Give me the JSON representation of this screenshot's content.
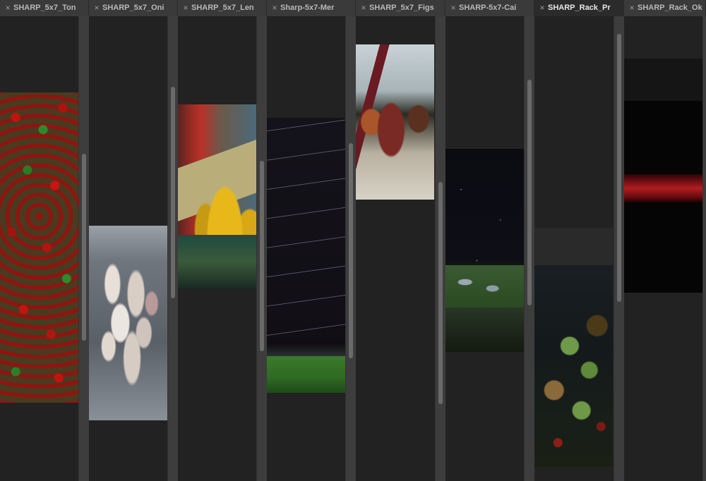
{
  "tabs": [
    {
      "title": "SHARP_5x7_Ton",
      "close": "×"
    },
    {
      "title": "SHARP_5x7_Oni",
      "close": "×"
    },
    {
      "title": "SHARP_5x7_Len",
      "close": "×"
    },
    {
      "title": "Sharp-5x7-Mer",
      "close": "×"
    },
    {
      "title": "SHARP_5x7_Figs",
      "close": "×"
    },
    {
      "title": "SHARP-5x7-Cai",
      "close": "×"
    },
    {
      "title": "SHARP_Rack_Pr",
      "close": "×"
    },
    {
      "title": "SHARP_Rack_Ok",
      "close": "×"
    }
  ],
  "active_tab_index": 6,
  "colors": {
    "background": "#2a2a2a",
    "panel": "#222222",
    "tab": "#3a3a3a",
    "tab_active": "#2b2b2b",
    "scroll_track": "#3d3d3d",
    "scroll_thumb": "#6a6a6a"
  },
  "images": [
    {
      "name": "tomatoes-photo"
    },
    {
      "name": "onions-photo"
    },
    {
      "name": "lemons-photo"
    },
    {
      "name": "stars-stones-photo"
    },
    {
      "name": "figs-photo"
    },
    {
      "name": "stars-rocks-photo"
    },
    {
      "name": "green-tomatoes-photo"
    },
    {
      "name": "red-blur-photo"
    }
  ]
}
